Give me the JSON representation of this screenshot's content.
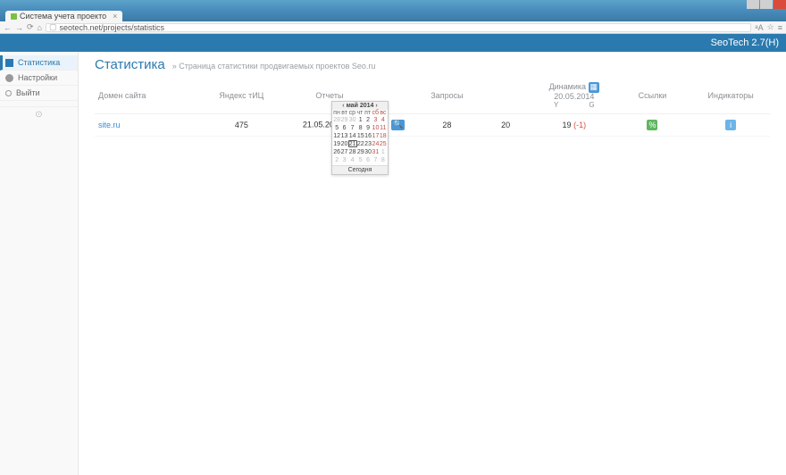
{
  "browser": {
    "tab_title": "Система учета проекто",
    "url_display": "seotech.net/projects/statistics"
  },
  "app": {
    "brand": "SeoTech 2.7(H)"
  },
  "sidebar": {
    "items": [
      {
        "label": "Статистика"
      },
      {
        "label": "Настройки"
      },
      {
        "label": "Выйти"
      }
    ]
  },
  "page": {
    "title": "Статистика",
    "crumb": "» Страница статистики продвигаемых проектов Seo.ru"
  },
  "table": {
    "headers": {
      "domain": "Домен сайта",
      "tic": "Яндекс тИЦ",
      "reports": "Отчеты",
      "queries": "Запросы",
      "dynamics": "Динамика",
      "dynamics_date": "20.05.2014",
      "dyn_y": "Y",
      "dyn_g": "G",
      "links": "Ссылки",
      "indicators": "Индикаторы"
    },
    "rows": [
      {
        "domain": "site.ru",
        "tic": "475",
        "report_date": "21.05.2014",
        "q_left": "28",
        "q_right": "20",
        "dyn_val": "19",
        "dyn_diff": "(-1)"
      }
    ]
  },
  "icons": {
    "calendar_char": "▦",
    "search_char": "🔍",
    "link_char": "%",
    "info_char": "i"
  },
  "calendar": {
    "title": "май 2014",
    "prev": "‹",
    "next": "›",
    "dow": [
      "пн",
      "вт",
      "ср",
      "чт",
      "пт",
      "сб",
      "вс"
    ],
    "weeks": [
      [
        {
          "n": "28",
          "t": "mute"
        },
        {
          "n": "29",
          "t": "mute"
        },
        {
          "n": "30",
          "t": "mute"
        },
        {
          "n": "1",
          "t": ""
        },
        {
          "n": "2",
          "t": ""
        },
        {
          "n": "3",
          "t": "we"
        },
        {
          "n": "4",
          "t": "we"
        }
      ],
      [
        {
          "n": "5",
          "t": ""
        },
        {
          "n": "6",
          "t": ""
        },
        {
          "n": "7",
          "t": ""
        },
        {
          "n": "8",
          "t": ""
        },
        {
          "n": "9",
          "t": ""
        },
        {
          "n": "10",
          "t": "we"
        },
        {
          "n": "11",
          "t": "we"
        }
      ],
      [
        {
          "n": "12",
          "t": ""
        },
        {
          "n": "13",
          "t": ""
        },
        {
          "n": "14",
          "t": ""
        },
        {
          "n": "15",
          "t": ""
        },
        {
          "n": "16",
          "t": ""
        },
        {
          "n": "17",
          "t": "we"
        },
        {
          "n": "18",
          "t": "we"
        }
      ],
      [
        {
          "n": "19",
          "t": ""
        },
        {
          "n": "20",
          "t": ""
        },
        {
          "n": "21",
          "t": "today"
        },
        {
          "n": "22",
          "t": ""
        },
        {
          "n": "23",
          "t": ""
        },
        {
          "n": "24",
          "t": "we"
        },
        {
          "n": "25",
          "t": "we"
        }
      ],
      [
        {
          "n": "26",
          "t": ""
        },
        {
          "n": "27",
          "t": ""
        },
        {
          "n": "28",
          "t": ""
        },
        {
          "n": "29",
          "t": ""
        },
        {
          "n": "30",
          "t": ""
        },
        {
          "n": "31",
          "t": "we"
        },
        {
          "n": "1",
          "t": "mute"
        }
      ],
      [
        {
          "n": "2",
          "t": "mute"
        },
        {
          "n": "3",
          "t": "mute"
        },
        {
          "n": "4",
          "t": "mute"
        },
        {
          "n": "5",
          "t": "mute"
        },
        {
          "n": "6",
          "t": "mute"
        },
        {
          "n": "7",
          "t": "mute"
        },
        {
          "n": "8",
          "t": "mute"
        }
      ]
    ],
    "today_label": "Сегодня"
  }
}
